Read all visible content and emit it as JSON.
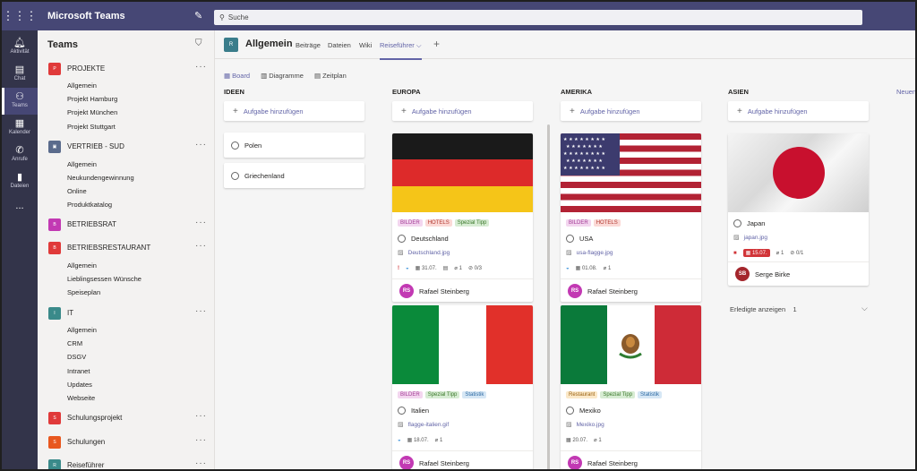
{
  "app": {
    "title": "Microsoft Teams",
    "search_placeholder": "Suche"
  },
  "rail": [
    {
      "icon": "bell-icon",
      "label": "Aktivität"
    },
    {
      "icon": "chat-icon",
      "label": "Chat"
    },
    {
      "icon": "teams-icon",
      "label": "Teams"
    },
    {
      "icon": "calendar-icon",
      "label": "Kalender"
    },
    {
      "icon": "phone-icon",
      "label": "Anrufe"
    },
    {
      "icon": "file-icon",
      "label": "Dateien"
    },
    {
      "icon": "more-icon",
      "label": "..."
    }
  ],
  "sidebar": {
    "title": "Teams",
    "teams": [
      {
        "name": "PROJEKTE",
        "abbr": "P",
        "color": "#e03a3a",
        "channels": [
          "Allgemein",
          "Projekt Hamburg",
          "Projekt München",
          "Projekt Stuttgart"
        ]
      },
      {
        "name": "VERTRIEB - SUD",
        "abbr": "",
        "color": "#5a6b8c",
        "channels": [
          "Allgemein",
          "Neukundengewinnung",
          "Online",
          "Produktkatalog"
        ]
      },
      {
        "name": "BETRIEBSRAT",
        "abbr": "B",
        "color": "#c239b3",
        "channels": []
      },
      {
        "name": "BETRIEBSRESTAURANT",
        "abbr": "B",
        "color": "#e03a3a",
        "channels": [
          "Allgemein",
          "Lieblingsessen Wünsche",
          "Speiseplan"
        ]
      },
      {
        "name": "IT",
        "abbr": "I",
        "color": "#3a8a8a",
        "channels": [
          "Allgemein",
          "CRM",
          "DSGV",
          "Intranet",
          "Updates",
          "Webseite"
        ]
      },
      {
        "name": "Schulungsprojekt",
        "abbr": "S",
        "color": "#e03a3a",
        "channels": []
      },
      {
        "name": "Schulungen",
        "abbr": "S",
        "color": "#e8571e",
        "channels": []
      },
      {
        "name": "Reiseführer",
        "abbr": "R",
        "color": "#3a8a8a",
        "channels": []
      }
    ],
    "more": "···"
  },
  "channel": {
    "abbr": "R",
    "name": "Allgemein",
    "tabs": [
      "Beiträge",
      "Dateien",
      "Wiki",
      "Reiseführer ⌵"
    ],
    "add_tab": "+"
  },
  "views": [
    "Board",
    "Diagramme",
    "Zeitplan"
  ],
  "planner": {
    "add_task": "Aufgabe hinzufügen",
    "new_bucket": "Neuen",
    "buckets": [
      {
        "title": "IDEEN",
        "tasks": [
          "Polen",
          "Griechenland"
        ]
      },
      {
        "title": "EUROPA"
      },
      {
        "title": "AMERIKA"
      },
      {
        "title": "ASIEN"
      }
    ],
    "cards": {
      "deutschland": {
        "labels": [
          "BILDER",
          "HOTELS",
          "Spezial Tipp"
        ],
        "title": "Deutschland",
        "attachment": "Deutschland.jpg",
        "priority": "!",
        "date": "31.07.",
        "checklist": "0/3",
        "attach_count": "1",
        "assignee_initials": "RS",
        "assignee": "Rafael Steinberg"
      },
      "italien": {
        "labels": [
          "BILDER",
          "Spezial Tipp",
          "Statistik"
        ],
        "title": "Italien",
        "attachment": "flagge-italien.gif",
        "date": "18.07.",
        "attach_count": "1",
        "assignee_initials": "RS",
        "assignee": "Rafael Steinberg"
      },
      "usa": {
        "labels": [
          "BILDER",
          "HOTELS"
        ],
        "title": "USA",
        "attachment": "usa-flagge.jpg",
        "date": "01.08.",
        "attach_count": "1",
        "assignee_initials": "RS",
        "assignee": "Rafael Steinberg"
      },
      "mexiko": {
        "labels": [
          "Restaurant",
          "Spezial Tipp",
          "Statistik"
        ],
        "title": "Mexiko",
        "attachment": "Mexiko.jpg",
        "date": "20.07.",
        "attach_count": "1",
        "assignee_initials": "RS",
        "assignee": "Rafael Steinberg"
      },
      "japan": {
        "title": "Japan",
        "attachment": "japan.jpg",
        "date": "15.07.",
        "attach_count": "1",
        "checklist": "0/1",
        "assignee_initials": "SB",
        "assignee": "Serge Birke"
      }
    },
    "completed": {
      "label": "Erledigte anzeigen",
      "count": "1"
    }
  },
  "colors": {
    "accent": "#6264a7",
    "header": "#464775",
    "rail": "#33344a",
    "rs_avatar": "#c239b3",
    "sb_avatar": "#a4262c",
    "overdue": "#d13438"
  }
}
